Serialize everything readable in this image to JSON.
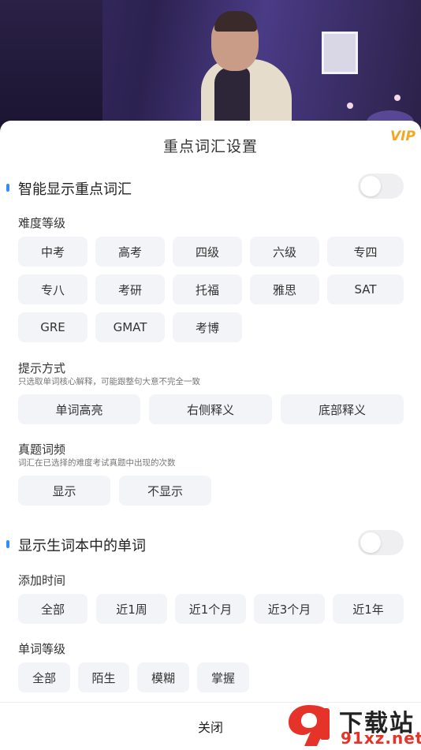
{
  "sheet": {
    "title": "重点词汇设置"
  },
  "section1": {
    "title": "智能显示重点词汇",
    "toggle_on": false,
    "difficulty": {
      "label": "难度等级",
      "options": [
        "中考",
        "高考",
        "四级",
        "六级",
        "专四",
        "专八",
        "考研",
        "托福",
        "雅思",
        "SAT",
        "GRE",
        "GMAT",
        "考博"
      ]
    },
    "hint": {
      "label": "提示方式",
      "desc": "只选取单词核心解释，可能跟整句大意不完全一致",
      "options": [
        "单词高亮",
        "右侧释义",
        "底部释义"
      ]
    },
    "freq": {
      "label": "真题词频",
      "desc": "词汇在已选择的难度考试真题中出现的次数",
      "options": [
        "显示",
        "不显示"
      ]
    }
  },
  "section2": {
    "title": "显示生词本中的单词",
    "toggle_on": false,
    "time": {
      "label": "添加时间",
      "options": [
        "全部",
        "近1周",
        "近1个月",
        "近3个月",
        "近1年"
      ]
    },
    "level": {
      "label": "单词等级",
      "options": [
        "全部",
        "陌生",
        "模糊",
        "掌握"
      ]
    }
  },
  "footer": {
    "close_label": "关闭"
  },
  "watermark": {
    "text_cn": "下载站",
    "text_url": "91xz.net"
  },
  "colors": {
    "accent": "#2f8cff",
    "vip": "#f5a623",
    "watermark_red": "#e6332a"
  },
  "icons": {
    "vip": "vip-badge-icon"
  }
}
